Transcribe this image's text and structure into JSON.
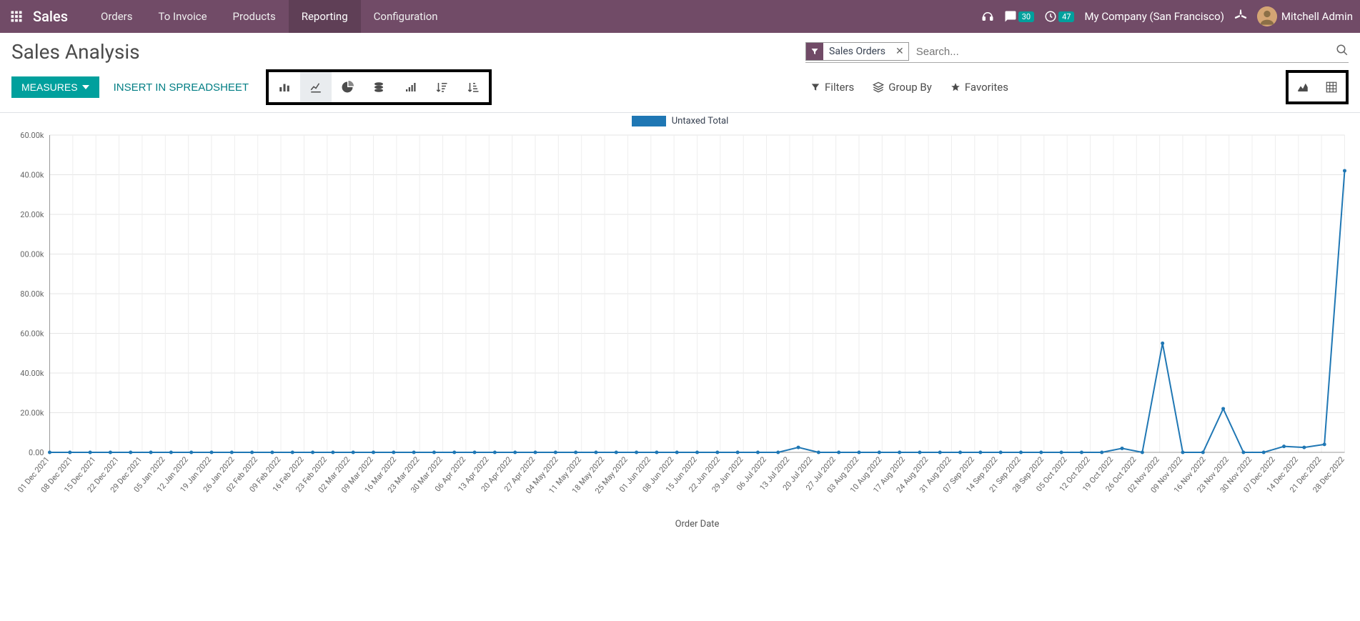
{
  "navbar": {
    "brand": "Sales",
    "menu": [
      "Orders",
      "To Invoice",
      "Products",
      "Reporting",
      "Configuration"
    ],
    "active_menu_index": 3,
    "messages_badge": "30",
    "activities_badge": "47",
    "company": "My Company (San Francisco)",
    "user": "Mitchell Admin"
  },
  "page": {
    "title": "Sales Analysis",
    "measures_label": "MEASURES",
    "insert_label": "INSERT IN SPREADSHEET",
    "search_facet": "Sales Orders",
    "search_placeholder": "Search...",
    "filters_label": "Filters",
    "groupby_label": "Group By",
    "favorites_label": "Favorites"
  },
  "chart_data": {
    "type": "line",
    "title": "",
    "legend": [
      "Untaxed Total"
    ],
    "xlabel": "Order Date",
    "ylabel": "",
    "ylim": [
      0,
      160000
    ],
    "yticks": [
      "0.00",
      "20.00k",
      "40.00k",
      "60.00k",
      "80.00k",
      "00.00k",
      "20.00k",
      "40.00k",
      "60.00k"
    ],
    "categories": [
      "01 Dec 2021",
      "08 Dec 2021",
      "15 Dec 2021",
      "22 Dec 2021",
      "29 Dec 2021",
      "05 Jan 2022",
      "12 Jan 2022",
      "19 Jan 2022",
      "26 Jan 2022",
      "02 Feb 2022",
      "09 Feb 2022",
      "16 Feb 2022",
      "23 Feb 2022",
      "02 Mar 2022",
      "09 Mar 2022",
      "16 Mar 2022",
      "23 Mar 2022",
      "30 Mar 2022",
      "06 Apr 2022",
      "13 Apr 2022",
      "20 Apr 2022",
      "27 Apr 2022",
      "04 May 2022",
      "11 May 2022",
      "18 May 2022",
      "25 May 2022",
      "01 Jun 2022",
      "08 Jun 2022",
      "15 Jun 2022",
      "22 Jun 2022",
      "29 Jun 2022",
      "06 Jul 2022",
      "13 Jul 2022",
      "20 Jul 2022",
      "27 Jul 2022",
      "03 Aug 2022",
      "10 Aug 2022",
      "17 Aug 2022",
      "24 Aug 2022",
      "31 Aug 2022",
      "07 Sep 2022",
      "14 Sep 2022",
      "21 Sep 2022",
      "28 Sep 2022",
      "05 Oct 2022",
      "12 Oct 2022",
      "19 Oct 2022",
      "26 Oct 2022",
      "02 Nov 2022",
      "09 Nov 2022",
      "16 Nov 2022",
      "23 Nov 2022",
      "30 Nov 2022",
      "07 Dec 2022",
      "14 Dec 2022",
      "21 Dec 2022",
      "28 Dec 2022"
    ],
    "series": [
      {
        "name": "Untaxed Total",
        "values_dense": true,
        "color": "#1f77b4",
        "values": [
          0,
          0,
          0,
          0,
          0,
          0,
          0,
          0,
          0,
          0,
          0,
          0,
          0,
          0,
          0,
          0,
          0,
          0,
          0,
          0,
          0,
          0,
          0,
          0,
          0,
          0,
          0,
          0,
          0,
          0,
          0,
          0,
          0,
          0,
          0,
          0,
          0,
          2500,
          0,
          0,
          0,
          0,
          0,
          0,
          0,
          0,
          0,
          0,
          0,
          0,
          0,
          0,
          0,
          2000,
          0,
          55000,
          0,
          0,
          22000,
          0,
          0,
          3000,
          2500,
          4000,
          142000
        ]
      }
    ]
  }
}
